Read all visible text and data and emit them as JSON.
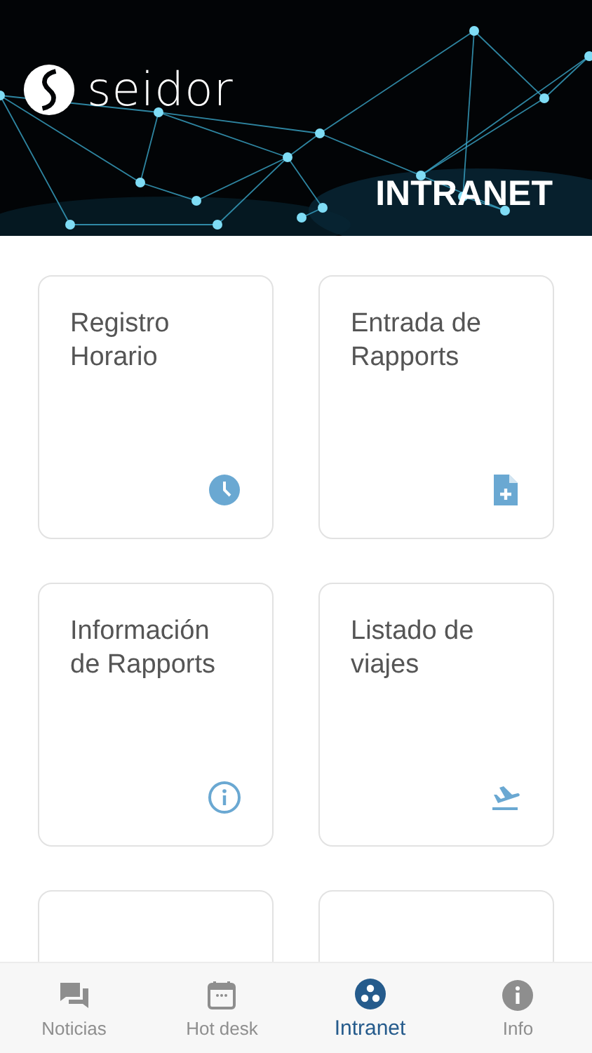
{
  "header": {
    "logo_text": "seidor",
    "title": "INTRANET"
  },
  "cards": [
    {
      "kind": "tile",
      "title": "Registro Horario"
    },
    {
      "kind": "tile",
      "title": "Entrada de Rapports"
    },
    {
      "kind": "tile",
      "title": "Información de Rapports"
    },
    {
      "kind": "tile",
      "title": "Listado de viajes"
    },
    {
      "kind": "stub"
    },
    {
      "kind": "stub"
    }
  ],
  "tabs": [
    {
      "label": "Noticias",
      "selected": false
    },
    {
      "label": "Hot desk",
      "selected": false
    },
    {
      "label": "Intranet",
      "selected": true
    },
    {
      "label": "Info",
      "selected": false
    }
  ]
}
